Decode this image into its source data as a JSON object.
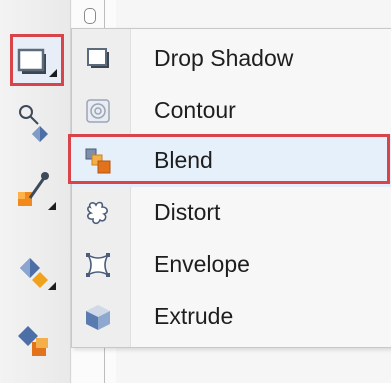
{
  "colors": {
    "highlight_border": "#d9444a",
    "highlight_fill": "#e6f0fb",
    "menu_bg": "#f7f7f7",
    "text": "#1e1e1e"
  },
  "toolbox": {
    "tools": [
      {
        "name": "effects-flyout",
        "icon": "drop-shadow-tool-icon",
        "selected": true
      },
      {
        "name": "transparency-tool",
        "icon": "transparency-tool-icon",
        "selected": false
      },
      {
        "name": "eyedropper-tool",
        "icon": "eyedropper-tool-icon",
        "selected": false
      },
      {
        "name": "interactive-fill-tool",
        "icon": "interactive-fill-tool-icon",
        "selected": false
      },
      {
        "name": "blend-tool",
        "icon": "blend-tool-icon",
        "selected": false
      }
    ]
  },
  "menu": {
    "items": [
      {
        "label": "Drop Shadow",
        "icon": "drop-shadow-icon",
        "highlighted": false
      },
      {
        "label": "Contour",
        "icon": "contour-icon",
        "highlighted": false
      },
      {
        "label": "Blend",
        "icon": "blend-icon",
        "highlighted": true
      },
      {
        "label": "Distort",
        "icon": "distort-icon",
        "highlighted": false
      },
      {
        "label": "Envelope",
        "icon": "envelope-icon",
        "highlighted": false
      },
      {
        "label": "Extrude",
        "icon": "extrude-icon",
        "highlighted": false
      }
    ]
  }
}
